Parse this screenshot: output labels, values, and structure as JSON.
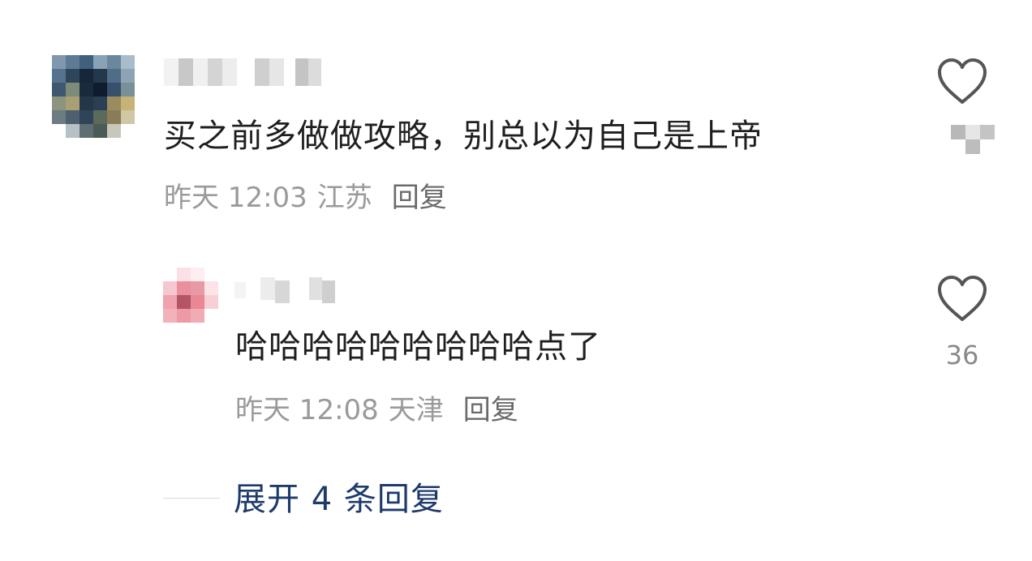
{
  "comments": [
    {
      "text": "买之前多做做攻略，别总以为自己是上帝",
      "time": "昨天 12:03",
      "location": "江苏",
      "reply_label": "回复",
      "like_icon": "heart-outline-icon"
    }
  ],
  "reply": {
    "text": "哈哈哈哈哈哈哈哈哈点了",
    "time": "昨天 12:08",
    "location": "天津",
    "reply_label": "回复",
    "like_count": "36",
    "like_icon": "heart-outline-icon"
  },
  "expand_replies_label": "展开 4 条回复",
  "colors": {
    "text_primary": "#1f1f1f",
    "text_meta": "#9a9a9a",
    "link_blue": "#1d3a6b",
    "icon_gray": "#555555"
  }
}
